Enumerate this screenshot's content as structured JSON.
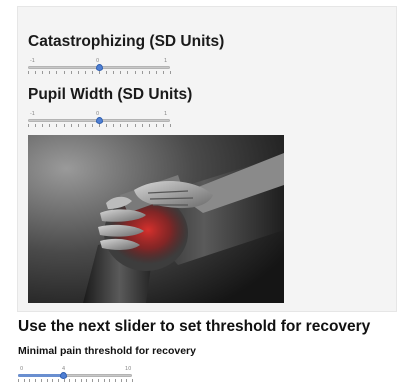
{
  "catastrophizing_slider": {
    "label": "Catastrophizing (SD Units)",
    "min_label": "-1",
    "mid_label": "0",
    "max_label": "1",
    "value_fraction": 0.5
  },
  "pupil_slider": {
    "label": "Pupil Width (SD Units)",
    "min_label": "-1",
    "mid_label": "0",
    "max_label": "1",
    "value_fraction": 0.5
  },
  "image": {
    "subject": "knee-pain-photo",
    "accent_color": "#c0282a"
  },
  "recovery": {
    "heading": "Use the next slider to set threshold for recovery",
    "slider_label": "Minimal pain threshold for recovery",
    "min_label": "0",
    "value_label": "4",
    "max_label": "10",
    "value_fraction": 0.4
  },
  "colors": {
    "panel_bg": "#f4f4f4",
    "handle": "#4f7fd4"
  }
}
